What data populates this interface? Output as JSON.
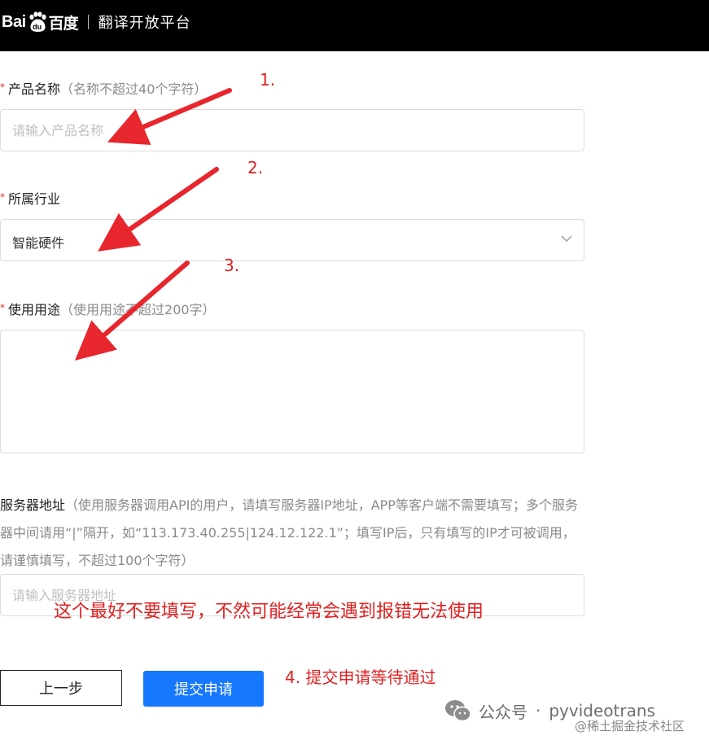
{
  "header": {
    "logo_text_latin": "Bai",
    "logo_paw_text": "du",
    "logo_text_cn": "百度",
    "platform": "翻译开放平台"
  },
  "form": {
    "product_name": {
      "required_mark": "*",
      "label": "产品名称",
      "hint": "（名称不超过40个字符）",
      "placeholder": "请输入产品名称"
    },
    "industry": {
      "required_mark": "*",
      "label": "所属行业",
      "selected": "智能硬件"
    },
    "usage": {
      "required_mark": "*",
      "label": "使用用途",
      "hint": "（使用用途不超过200字）",
      "value": ""
    },
    "server": {
      "label": "服务器地址",
      "hint": "（使用服务器调用API的用户，请填写服务器IP地址，APP等客户端不需要填写；多个服务器中间请用“|”隔开，如“113.173.40.255|124.12.122.1”；填写IP后，只有填写的IP才可被调用，请谨慎填写，不超过100个字符）",
      "placeholder": "请输入服务器地址"
    },
    "buttons": {
      "prev": "上一步",
      "submit": "提交申请"
    }
  },
  "annotations": {
    "step1": "1.",
    "step2": "2.",
    "step3": "3.",
    "server_note": "这个最好不要填写，不然可能经常会遇到报错无法使用",
    "step4": "4. 提交申请等待通过"
  },
  "watermark": {
    "account": "公众号",
    "separator": "·",
    "name": "pyvideotrans",
    "site": "@稀土掘金技术社区"
  },
  "colors": {
    "header_bg": "#000000",
    "primary": "#1677ff",
    "required": "#e0301e",
    "annotation": "#e02020"
  },
  "icons": {
    "logo": "baidu-paw-icon",
    "select_caret": "chevron-down-icon",
    "watermark": "wechat-icon"
  }
}
